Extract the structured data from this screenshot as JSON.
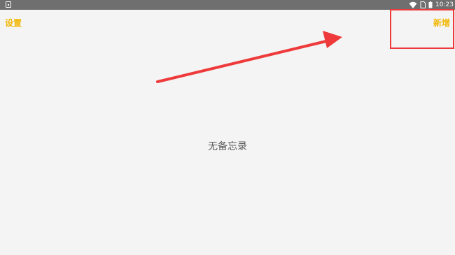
{
  "status_bar": {
    "time": "10:23",
    "icons": [
      "app-notification-icon",
      "wifi-icon",
      "sim-icon",
      "battery-icon"
    ]
  },
  "header": {
    "settings_label": "设置",
    "add_label": "新增"
  },
  "main": {
    "empty_text": "无备忘录"
  },
  "colors": {
    "background": "#f4f4f4",
    "status_bar": "#6f6f6f",
    "accent": "#f2b705",
    "annotation": "#ee3a3a",
    "text_muted": "#5a5a5a"
  }
}
